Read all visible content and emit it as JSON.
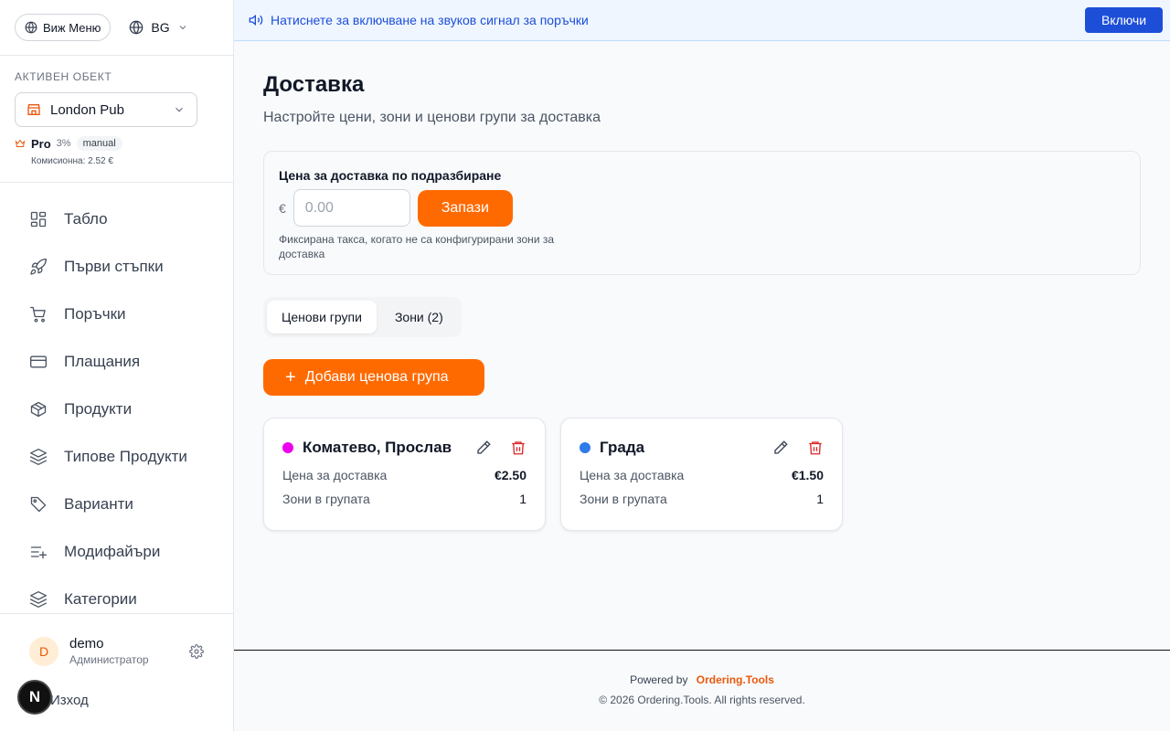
{
  "header": {
    "view_menu_label": "Виж Меню",
    "language": "BG"
  },
  "active_object": {
    "label": "АКТИВЕН ОБЕКТ",
    "name": "London Pub",
    "plan": "Pro",
    "plan_percent": "3%",
    "plan_badge": "manual",
    "commission": "Комисионна: 2.52 €"
  },
  "sidebar": {
    "items": [
      {
        "label": "Табло",
        "icon": "dashboard-icon"
      },
      {
        "label": "Първи стъпки",
        "icon": "rocket-icon"
      },
      {
        "label": "Поръчки",
        "icon": "cart-icon"
      },
      {
        "label": "Плащания",
        "icon": "credit-card-icon"
      },
      {
        "label": "Продукти",
        "icon": "box-icon"
      },
      {
        "label": "Типове Продукти",
        "icon": "layers-icon"
      },
      {
        "label": "Варианти",
        "icon": "tag-icon"
      },
      {
        "label": "Модифайъри",
        "icon": "list-plus-icon"
      },
      {
        "label": "Категории",
        "icon": "layers-icon"
      }
    ]
  },
  "user": {
    "initial": "D",
    "name": "demo",
    "role": "Администратор",
    "logout_label": "Изход"
  },
  "banner": {
    "text": "Натиснете за включване на звуков сигнал за поръчки",
    "button_label": "Включи"
  },
  "page": {
    "title": "Доставка",
    "subtitle": "Настройте цени, зони и ценови групи за доставка"
  },
  "default_price": {
    "label": "Цена за доставка по подразбиране",
    "currency": "€",
    "placeholder": "0.00",
    "save_label": "Запази",
    "help": "Фиксирана такса, когато не са конфигурирани зони за доставка"
  },
  "tabs": [
    {
      "label": "Ценови групи",
      "active": true
    },
    {
      "label": "Зони (2)",
      "active": false
    }
  ],
  "add_group_label": "Добави ценова група",
  "groups": [
    {
      "name": "Коматево, Прослав",
      "color": "#ee00ee",
      "price_label": "Цена за доставка",
      "price": "€2.50",
      "zones_label": "Зони в групата",
      "zones": "1"
    },
    {
      "name": "Града",
      "color": "#2f7be8",
      "price_label": "Цена за доставка",
      "price": "€1.50",
      "zones_label": "Зони в групата",
      "zones": "1"
    }
  ],
  "footer": {
    "powered_by": "Powered by",
    "brand": "Ordering.Tools",
    "copyright": "© 2026 Ordering.Tools. All rights reserved."
  },
  "colors": {
    "accent": "#ff6a00",
    "banner_blue": "#1d4ed8"
  }
}
